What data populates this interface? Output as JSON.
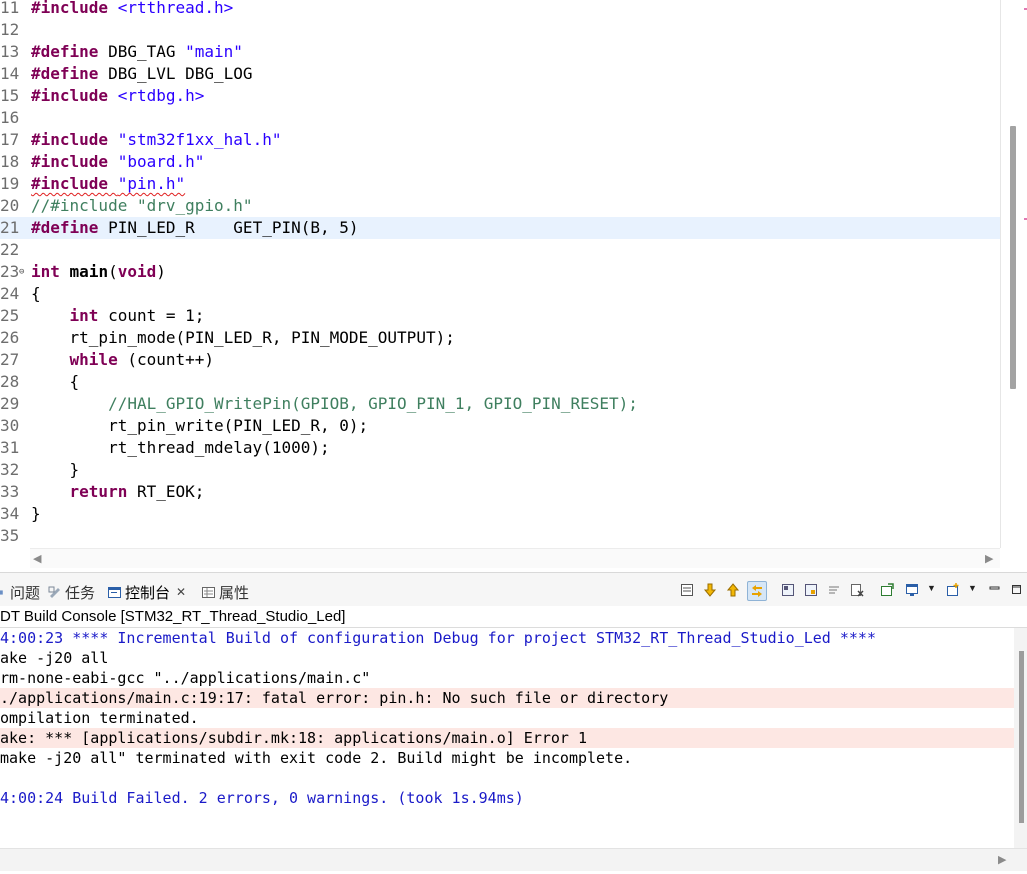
{
  "editor": {
    "lines": [
      {
        "n": "11",
        "fold": false,
        "tokens": [
          {
            "t": "kw",
            "v": "#include"
          },
          {
            "t": "p",
            "v": " "
          },
          {
            "t": "str",
            "v": "<rtthread.h>"
          }
        ]
      },
      {
        "n": "12",
        "fold": false,
        "tokens": []
      },
      {
        "n": "13",
        "fold": false,
        "tokens": [
          {
            "t": "kw",
            "v": "#define"
          },
          {
            "t": "p",
            "v": " DBG_TAG "
          },
          {
            "t": "str",
            "v": "\"main\""
          }
        ]
      },
      {
        "n": "14",
        "fold": false,
        "tokens": [
          {
            "t": "kw",
            "v": "#define"
          },
          {
            "t": "p",
            "v": " DBG_LVL DBG_LOG"
          }
        ]
      },
      {
        "n": "15",
        "fold": false,
        "tokens": [
          {
            "t": "kw",
            "v": "#include"
          },
          {
            "t": "p",
            "v": " "
          },
          {
            "t": "str",
            "v": "<rtdbg.h>"
          }
        ]
      },
      {
        "n": "16",
        "fold": false,
        "tokens": []
      },
      {
        "n": "17",
        "fold": false,
        "tokens": [
          {
            "t": "kw",
            "v": "#include"
          },
          {
            "t": "p",
            "v": " "
          },
          {
            "t": "str",
            "v": "\"stm32f1xx_hal.h\""
          }
        ]
      },
      {
        "n": "18",
        "fold": false,
        "tokens": [
          {
            "t": "kw",
            "v": "#include"
          },
          {
            "t": "p",
            "v": " "
          },
          {
            "t": "str",
            "v": "\"board.h\""
          }
        ]
      },
      {
        "n": "19",
        "fold": false,
        "tokens": [
          {
            "t": "kw squig",
            "v": "#include"
          },
          {
            "t": "squig",
            "v": " "
          },
          {
            "t": "str squig",
            "v": "\"pin.h\""
          }
        ]
      },
      {
        "n": "20",
        "fold": false,
        "tokens": [
          {
            "t": "cmt",
            "v": "//#include \"drv_gpio.h\""
          }
        ]
      },
      {
        "n": "21",
        "fold": false,
        "current": true,
        "tokens": [
          {
            "t": "kw",
            "v": "#define"
          },
          {
            "t": "p",
            "v": " PIN_LED_R    GET_PIN(B, 5)"
          }
        ]
      },
      {
        "n": "22",
        "fold": false,
        "tokens": []
      },
      {
        "n": "23",
        "fold": true,
        "tokens": [
          {
            "t": "kw",
            "v": "int"
          },
          {
            "t": "p",
            "v": " "
          },
          {
            "t": "b",
            "v": "main"
          },
          {
            "t": "p",
            "v": "("
          },
          {
            "t": "kw",
            "v": "void"
          },
          {
            "t": "p",
            "v": ")"
          }
        ]
      },
      {
        "n": "24",
        "fold": false,
        "tokens": [
          {
            "t": "p",
            "v": "{"
          }
        ]
      },
      {
        "n": "25",
        "fold": false,
        "tokens": [
          {
            "t": "p",
            "v": "    "
          },
          {
            "t": "kw",
            "v": "int"
          },
          {
            "t": "p",
            "v": " count = 1;"
          }
        ]
      },
      {
        "n": "26",
        "fold": false,
        "tokens": [
          {
            "t": "p",
            "v": "    rt_pin_mode(PIN_LED_R, PIN_MODE_OUTPUT);"
          }
        ]
      },
      {
        "n": "27",
        "fold": false,
        "tokens": [
          {
            "t": "p",
            "v": "    "
          },
          {
            "t": "kw",
            "v": "while"
          },
          {
            "t": "p",
            "v": " (count++)"
          }
        ]
      },
      {
        "n": "28",
        "fold": false,
        "tokens": [
          {
            "t": "p",
            "v": "    {"
          }
        ]
      },
      {
        "n": "29",
        "fold": false,
        "tokens": [
          {
            "t": "p",
            "v": "        "
          },
          {
            "t": "cmt",
            "v": "//HAL_GPIO_WritePin(GPIOB, GPIO_PIN_1, GPIO_PIN_RESET);"
          }
        ]
      },
      {
        "n": "30",
        "fold": false,
        "tokens": [
          {
            "t": "p",
            "v": "        rt_pin_write(PIN_LED_R, 0);"
          }
        ]
      },
      {
        "n": "31",
        "fold": false,
        "tokens": [
          {
            "t": "p",
            "v": "        rt_thread_mdelay(1000);"
          }
        ]
      },
      {
        "n": "32",
        "fold": false,
        "tokens": [
          {
            "t": "p",
            "v": "    }"
          }
        ]
      },
      {
        "n": "33",
        "fold": false,
        "tokens": [
          {
            "t": "p",
            "v": "    "
          },
          {
            "t": "kw",
            "v": "return"
          },
          {
            "t": "p",
            "v": " RT_EOK;"
          }
        ]
      },
      {
        "n": "34",
        "fold": false,
        "tokens": [
          {
            "t": "p",
            "v": "}"
          }
        ]
      },
      {
        "n": "35",
        "fold": false,
        "tokens": []
      }
    ]
  },
  "panel": {
    "tabs": {
      "problems": "问题",
      "tasks": "任务",
      "console": "控制台",
      "properties": "属性"
    },
    "console_title": "DT Build Console [STM32_RT_Thread_Studio_Led]",
    "console_lines": [
      {
        "text": "4:00:23 **** Incremental Build of configuration Debug for project STM32_RT_Thread_Studio_Led ****",
        "kind": "info"
      },
      {
        "text": "ake -j20 all",
        "kind": "normal"
      },
      {
        "text": "rm-none-eabi-gcc \"../applications/main.c\"",
        "kind": "normal"
      },
      {
        "text": "./applications/main.c:19:17: fatal error: pin.h: No such file or directory",
        "kind": "err"
      },
      {
        "text": "ompilation terminated.",
        "kind": "normal"
      },
      {
        "text": "ake: *** [applications/subdir.mk:18: applications/main.o] Error 1",
        "kind": "err"
      },
      {
        "text": "make -j20 all\" terminated with exit code 2. Build might be incomplete.",
        "kind": "normal"
      },
      {
        "text": "",
        "kind": "normal"
      },
      {
        "text": "4:00:24 Build Failed. 2 errors, 0 warnings. (took 1s.94ms)",
        "kind": "info"
      }
    ]
  },
  "colors": {
    "keyword": "#7f0055",
    "string": "#2a00ff",
    "comment": "#3f7f5f",
    "current_line": "#e8f2fe",
    "error_line": "#fde7e3",
    "console_info": "#1a1ac8"
  }
}
